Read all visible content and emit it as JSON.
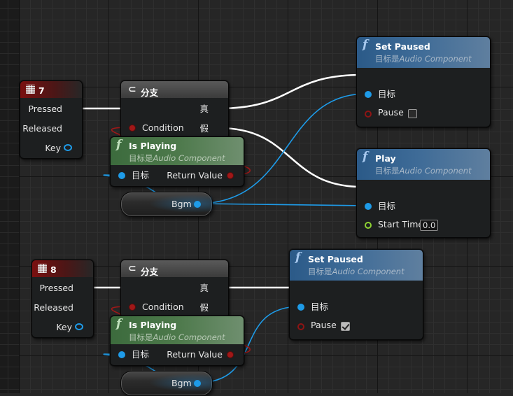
{
  "graph": {
    "key7_node": {
      "title": "7",
      "pins": {
        "pressed": "Pressed",
        "released": "Released",
        "key": "Key"
      }
    },
    "branch1": {
      "title": "分支",
      "pins": {
        "condition": "Condition",
        "true": "真",
        "false": "假"
      }
    },
    "is_playing1": {
      "title": "Is Playing",
      "target_prefix": "目标是",
      "target_class": "Audio Component",
      "pins": {
        "target": "目标",
        "return": "Return Value"
      }
    },
    "bgm1": {
      "label": "Bgm"
    },
    "set_paused1": {
      "title": "Set Paused",
      "target_prefix": "目标是",
      "target_class": "Audio Component",
      "pins": {
        "target": "目标",
        "pause": "Pause"
      },
      "pause_checked": false
    },
    "play1": {
      "title": "Play",
      "target_prefix": "目标是",
      "target_class": "Audio Component",
      "pins": {
        "target": "目标",
        "start_time": "Start Time"
      },
      "start_time_value": "0.0"
    },
    "key8_node": {
      "title": "8",
      "pins": {
        "pressed": "Pressed",
        "released": "Released",
        "key": "Key"
      }
    },
    "branch2": {
      "title": "分支",
      "pins": {
        "condition": "Condition",
        "true": "真",
        "false": "假"
      }
    },
    "is_playing2": {
      "title": "Is Playing",
      "target_prefix": "目标是",
      "target_class": "Audio Component",
      "pins": {
        "target": "目标",
        "return": "Return Value"
      }
    },
    "bgm2": {
      "label": "Bgm"
    },
    "set_paused2": {
      "title": "Set Paused",
      "target_prefix": "目标是",
      "target_class": "Audio Component",
      "pins": {
        "target": "目标",
        "pause": "Pause"
      },
      "pause_checked": true
    }
  },
  "colors": {
    "exec_wire": "#ffffff",
    "object_wire": "#1e9be8",
    "bool_pin": "#a01818",
    "float_pin": "#8ed233",
    "event_header": "#7a1010",
    "function_header": "#2b5a88",
    "pure_function_header": "#3c6b3d"
  },
  "icons": {
    "event": "keyboard-icon",
    "branch": "branch-icon",
    "function": "function-icon"
  }
}
